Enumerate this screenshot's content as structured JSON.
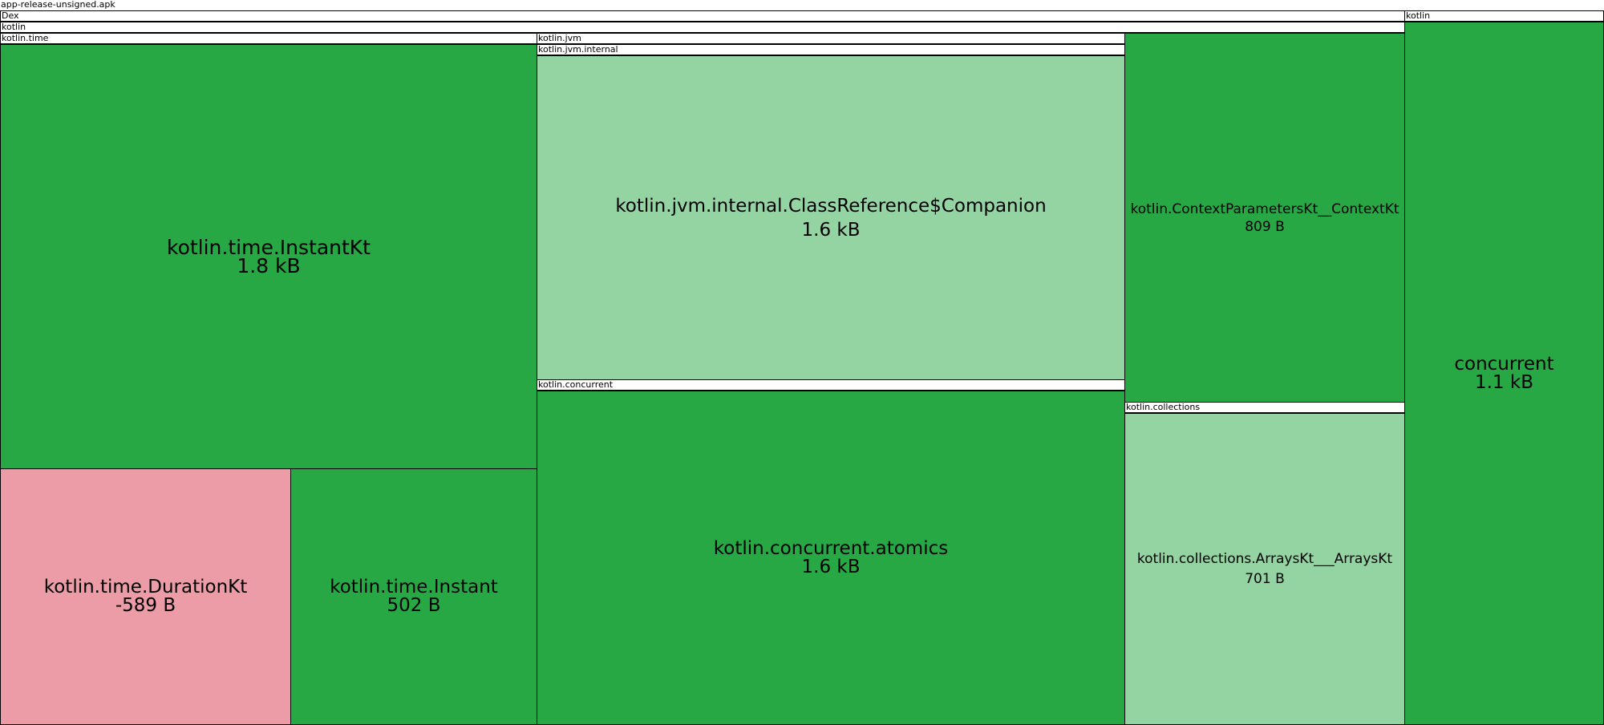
{
  "chart_data": {
    "type": "treemap",
    "root": "app-release-unsigned.apk",
    "containers": {
      "apk": "app-release-unsigned.apk",
      "dex": "Dex",
      "kotlin_main": "kotlin",
      "kotlin_right": "kotlin",
      "kotlin_time": "kotlin.time",
      "kotlin_jvm": "kotlin.jvm",
      "kotlin_jvm_internal": "kotlin.jvm.internal",
      "kotlin_concurrent": "kotlin.concurrent",
      "kotlin_collections": "kotlin.collections"
    },
    "leaves": [
      {
        "id": "instantkt",
        "name": "kotlin.time.InstantKt",
        "size": "1.8 kB",
        "bytes": 1800,
        "change": "increase",
        "color": "#28a745"
      },
      {
        "id": "durationkt",
        "name": "kotlin.time.DurationKt",
        "size": "-589 B",
        "bytes": -589,
        "change": "decrease",
        "color": "#eb9ca6"
      },
      {
        "id": "instant",
        "name": "kotlin.time.Instant",
        "size": "502 B",
        "bytes": 502,
        "change": "increase",
        "color": "#28a745"
      },
      {
        "id": "classref",
        "name": "kotlin.jvm.internal.ClassReference$Companion",
        "size": "1.6 kB",
        "bytes": 1600,
        "change": "added",
        "color": "#94d3a2"
      },
      {
        "id": "atomics",
        "name": "kotlin.concurrent.atomics",
        "size": "1.6 kB",
        "bytes": 1600,
        "change": "increase",
        "color": "#28a745"
      },
      {
        "id": "contextparams",
        "name": "kotlin.ContextParametersKt__ContextKt",
        "size": "809 B",
        "bytes": 809,
        "change": "increase",
        "color": "#28a745"
      },
      {
        "id": "arrayskt",
        "name": "kotlin.collections.ArraysKt___ArraysKt",
        "size": "701 B",
        "bytes": 701,
        "change": "added",
        "color": "#94d3a2"
      },
      {
        "id": "concurrent",
        "name": "concurrent",
        "size": "1.1 kB",
        "bytes": 1100,
        "change": "increase",
        "color": "#28a745"
      }
    ]
  }
}
